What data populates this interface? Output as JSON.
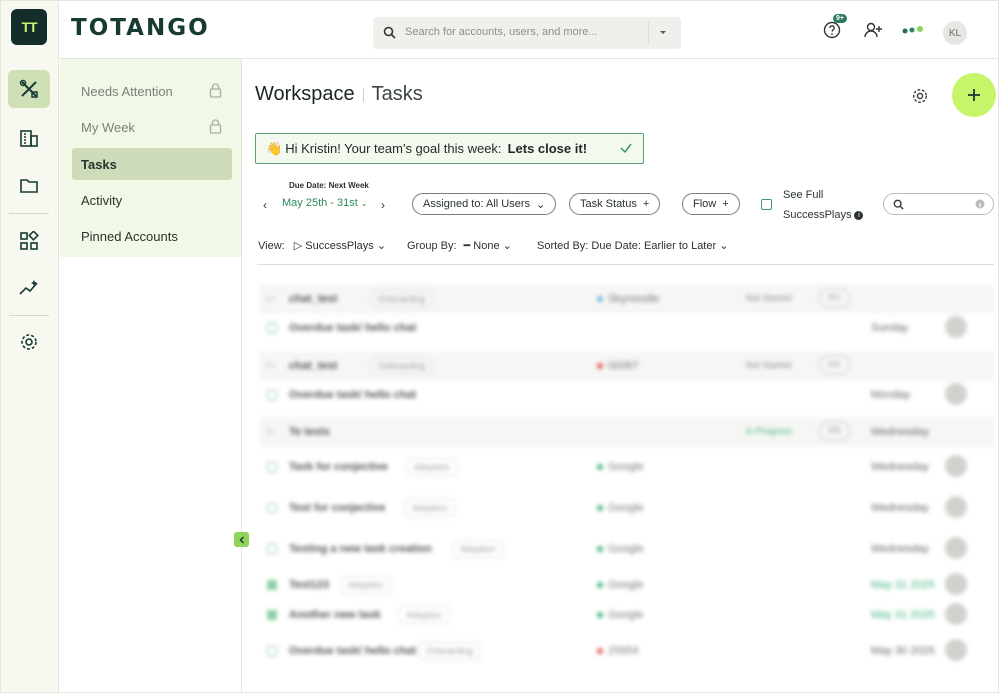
{
  "app": {
    "brand": "TOTANGO",
    "logo_text": "TT",
    "search_placeholder": "Search for accounts, users, and more...",
    "notification_count": "9+",
    "user_initials": "KL"
  },
  "rail": {
    "items": [
      {
        "icon": "tools-icon",
        "active": true
      },
      {
        "icon": "building-icon",
        "active": false
      },
      {
        "icon": "folder-icon",
        "active": false
      },
      {
        "icon": "dashboard-grid-icon",
        "active": false
      },
      {
        "icon": "insights-icon",
        "active": false
      },
      {
        "icon": "settings-gear-icon",
        "active": false
      }
    ]
  },
  "subnav": {
    "items": [
      {
        "label": "Needs Attention",
        "locked": true
      },
      {
        "label": "My Week",
        "locked": true
      },
      {
        "label": "Tasks",
        "active": true
      },
      {
        "label": "Activity"
      },
      {
        "label": "Pinned Accounts"
      }
    ]
  },
  "page": {
    "title": "Workspace",
    "subtitle": "Tasks"
  },
  "goal": {
    "emoji": "👋",
    "text": "Hi Kristin! Your team's goal this week:",
    "highlight": "Lets close it!"
  },
  "filters": {
    "due_label": "Due Date: Next Week",
    "due_range": "May 25th - 31st",
    "assigned": "Assigned to: All Users",
    "task_status": "Task Status",
    "flow": "Flow",
    "see_full_line1": "See Full",
    "see_full_line2": "SuccessPlays"
  },
  "viewbar": {
    "view_label": "View:",
    "view_value": "SuccessPlays",
    "group_label": "Group By:",
    "group_value": "None",
    "sort_label": "Sorted By: Due Date: Earlier to Later"
  },
  "tasks": [
    {
      "type": "group",
      "name": "chat_test",
      "tag": "Onboarding",
      "account": "Skynoodle",
      "status": "Not Started",
      "count": "0/1"
    },
    {
      "type": "task",
      "name": "Overdue task/ hello chat",
      "due": "Sunday"
    },
    {
      "type": "group",
      "name": "chat_test",
      "tag": "Onboarding",
      "account": "00067",
      "status": "Not Started",
      "count": "0/1"
    },
    {
      "type": "task",
      "name": "Overdue task/ hello chat",
      "due": "Monday"
    },
    {
      "type": "group",
      "name": "Te tests",
      "status": "In Progress",
      "count": "2/5",
      "due": "Wednesday"
    },
    {
      "type": "task",
      "name": "Task for conjective",
      "tag": "Adoption",
      "account": "Google",
      "due": "Wednesday"
    },
    {
      "type": "task",
      "name": "Test for conjective",
      "tag": "Adoption",
      "account": "Google",
      "due": "Wednesday"
    },
    {
      "type": "task",
      "name": "Testing a new task creation",
      "tag": "Adoption",
      "account": "Google",
      "due": "Wednesday"
    },
    {
      "type": "task",
      "done": true,
      "name": "Test123",
      "tag": "Adoption",
      "account": "Google",
      "due": "May 31 2025"
    },
    {
      "type": "task",
      "done": true,
      "name": "Another new task",
      "tag": "Adoption",
      "account": "Google",
      "due": "May 31 2025"
    },
    {
      "type": "task",
      "name": "Overdue task/ hello chat",
      "tag": "Onboarding",
      "account": "25654",
      "due": "May 30 2025"
    }
  ],
  "colors": {
    "accent": "#c7f56a",
    "brand_dark": "#142d2a",
    "green_text": "#2d8a59",
    "subnav_bg": "#f1f8e5"
  }
}
